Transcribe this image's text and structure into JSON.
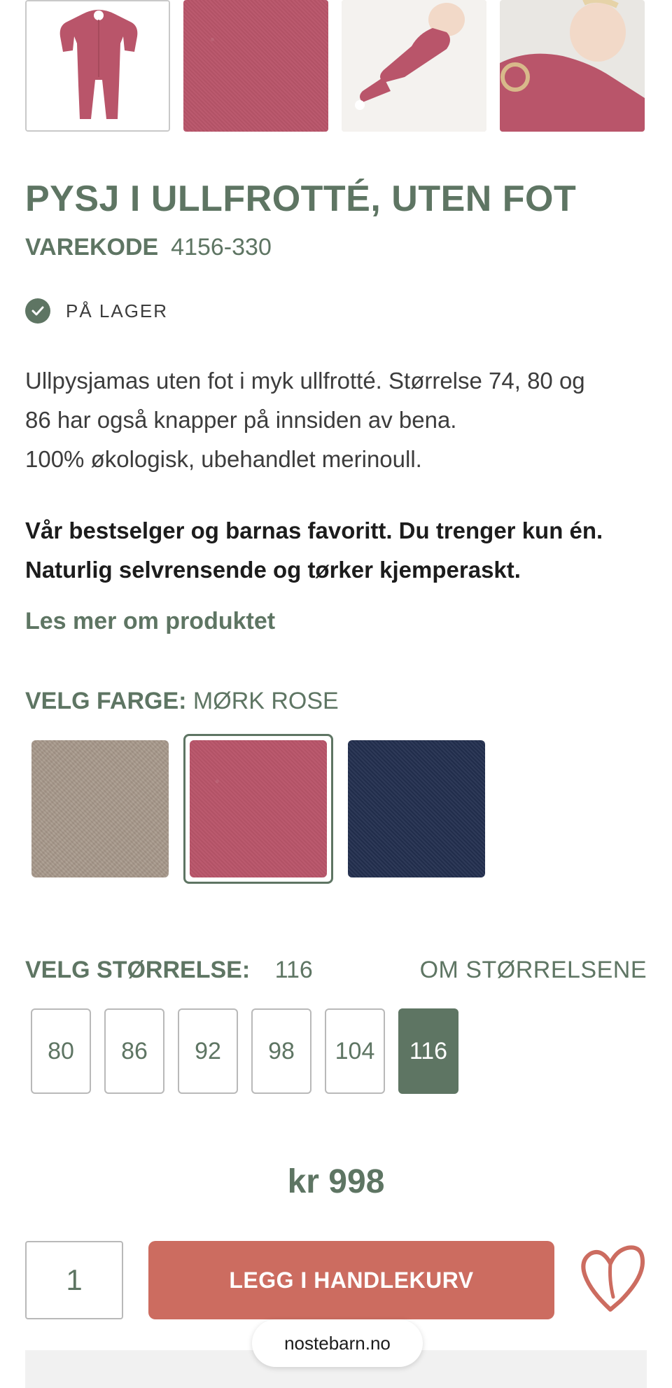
{
  "gallery": {
    "images": [
      {
        "name": "product-thumb-1",
        "kind": "romper-rose"
      },
      {
        "name": "product-thumb-2",
        "kind": "fabric-rose"
      },
      {
        "name": "product-thumb-3",
        "kind": "baby-photo"
      },
      {
        "name": "product-thumb-4",
        "kind": "baby-photo"
      }
    ]
  },
  "product": {
    "title": "PYSJ I ULLFROTTÉ, UTEN FOT",
    "code_label": "VAREKODE",
    "code_value": "4156-330",
    "stock_label": "PÅ LAGER",
    "description_lines": [
      "Ullpysjamas uten fot i myk ullfrotté. Størrelse 74, 80 og",
      "86 har også knapper på innsiden av bena.",
      "100% økologisk, ubehandlet merinoull."
    ],
    "highlight_lines": [
      "Vår bestselger og barnas favoritt. Du trenger kun én.",
      "Naturlig selvrensende og tørker kjemperaskt."
    ],
    "more_link": "Les mer om produktet"
  },
  "color": {
    "label": "VELG FARGE:",
    "selected": "MØRK ROSE",
    "swatches": [
      {
        "name": "beige",
        "hex": "#a8998b",
        "selected": false
      },
      {
        "name": "mork-rose",
        "hex": "#b9556a",
        "selected": true
      },
      {
        "name": "navy",
        "hex": "#232f4f",
        "selected": false
      }
    ]
  },
  "size": {
    "label": "VELG STØRRELSE:",
    "selected": "116",
    "guide_link": "OM STØRRELSENE",
    "options": [
      "80",
      "86",
      "92",
      "98",
      "104",
      "116"
    ]
  },
  "price": "kr 998",
  "cart": {
    "quantity": "1",
    "add_label": "LEGG I HANDLEKURV"
  },
  "browser": {
    "url": "nostebarn.no"
  },
  "colors": {
    "accent": "#5e7563",
    "cta": "#cc6c60"
  },
  "icons": {
    "stock": "check-icon",
    "wishlist": "heart-icon"
  }
}
